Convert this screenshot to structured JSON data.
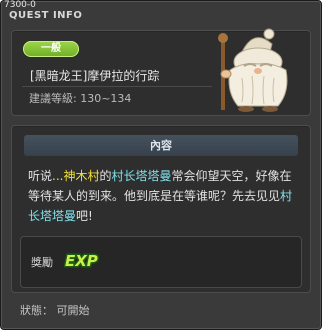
{
  "window": {
    "quest_id": "7300-0",
    "title": "QUEST INFO"
  },
  "quest": {
    "category_badge": "一般",
    "name": "[黑暗龙王]摩伊拉的行踪",
    "level_label": "建議等級",
    "level_range": "130~134"
  },
  "npc": {
    "icon": "white-bearded-elder-npc"
  },
  "content": {
    "section_title": "內容",
    "line1_a": "听说",
    "line1_dots": "...",
    "line1_village": "神木村",
    "line1_b": "的",
    "line1_npc": "村长塔塔曼",
    "line1_c": "常会仰望天空，好像在",
    "line2": "等待某人的到来。他到底是在等谁呢？先去见见",
    "line2_npc": "村",
    "line3_npc": "长塔塔曼",
    "line3_end": "吧!"
  },
  "reward": {
    "label": "獎勵",
    "icon": "exp-icon",
    "icon_text": "EXP"
  },
  "status": {
    "text": "狀態： 可開始"
  }
}
